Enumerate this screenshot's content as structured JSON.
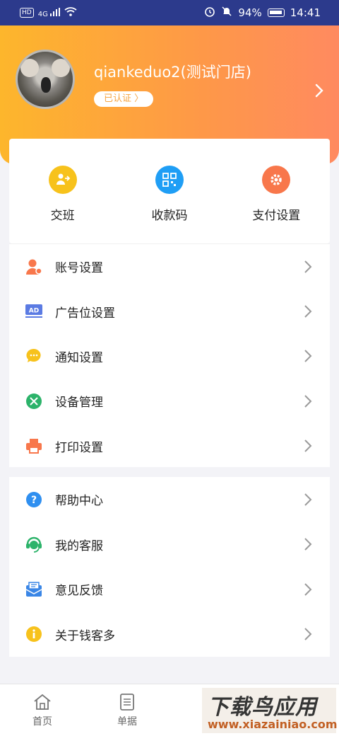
{
  "status_bar": {
    "network": "HD",
    "signal": "4G",
    "battery": "94%",
    "time": "14:41"
  },
  "profile": {
    "store_name": "qiankeduo2(测试门店)",
    "verified_label": "已认证 〉"
  },
  "quick_actions": [
    {
      "label": "交班",
      "icon": "handover-icon",
      "color": "#f7c21c"
    },
    {
      "label": "收款码",
      "icon": "qrcode-icon",
      "color": "#1f9ef5"
    },
    {
      "label": "支付设置",
      "icon": "gear-icon",
      "color": "#f8774b"
    }
  ],
  "settings_list": [
    {
      "label": "账号设置",
      "icon": "account-icon",
      "color": "#f8774b"
    },
    {
      "label": "广告位设置",
      "icon": "ad-icon",
      "color": "#5b7be3"
    },
    {
      "label": "通知设置",
      "icon": "message-icon",
      "color": "#f7c21c"
    },
    {
      "label": "设备管理",
      "icon": "tools-icon",
      "color": "#2cb36a"
    },
    {
      "label": "打印设置",
      "icon": "printer-icon",
      "color": "#f8774b"
    }
  ],
  "support_list": [
    {
      "label": "帮助中心",
      "icon": "help-icon",
      "color": "#2f8ff0"
    },
    {
      "label": "我的客服",
      "icon": "customer-service-icon",
      "color": "#2cb36a"
    },
    {
      "label": "意见反馈",
      "icon": "feedback-icon",
      "color": "#3a86e6"
    },
    {
      "label": "关于钱客多",
      "icon": "info-icon",
      "color": "#f7c21c"
    }
  ],
  "tab_bar": [
    {
      "label": "首页",
      "icon": "home-icon"
    },
    {
      "label": "单据",
      "icon": "document-icon"
    }
  ],
  "watermark": {
    "main": "下载鸟应用",
    "url": "www.xiazainiao.com"
  }
}
